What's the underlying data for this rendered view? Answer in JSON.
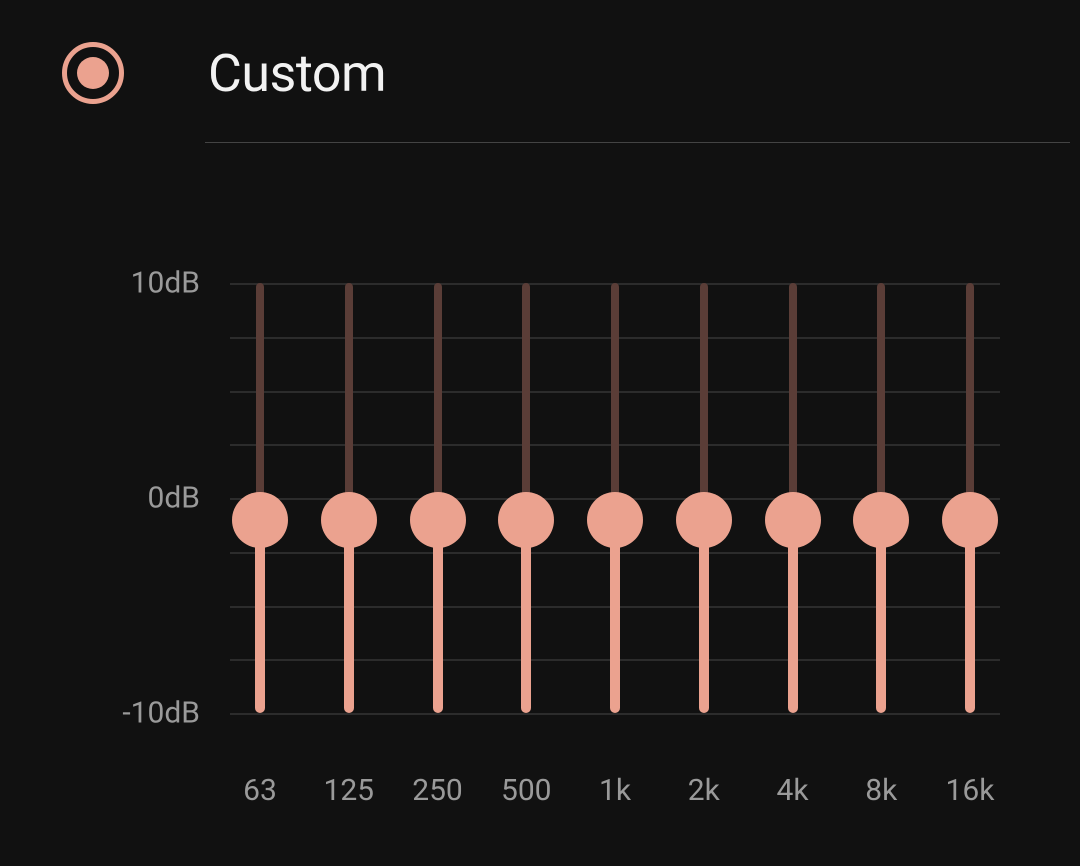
{
  "header": {
    "title": "Custom",
    "selected": true
  },
  "equalizer": {
    "y_axis": {
      "max_label": "10dB",
      "mid_label": "0dB",
      "min_label": "-10dB",
      "max": 10,
      "mid": 0,
      "min": -10
    },
    "gridlines_count": 8,
    "bands": [
      {
        "freq_label": "63",
        "value_db": -1
      },
      {
        "freq_label": "125",
        "value_db": -1
      },
      {
        "freq_label": "250",
        "value_db": -1
      },
      {
        "freq_label": "500",
        "value_db": -1
      },
      {
        "freq_label": "1k",
        "value_db": -1
      },
      {
        "freq_label": "2k",
        "value_db": -1
      },
      {
        "freq_label": "4k",
        "value_db": -1
      },
      {
        "freq_label": "8k",
        "value_db": -1
      },
      {
        "freq_label": "16k",
        "value_db": -1
      }
    ]
  },
  "chart_data": {
    "type": "bar",
    "title": "Custom",
    "xlabel": "",
    "ylabel": "dB",
    "ylim": [
      -10,
      10
    ],
    "categories": [
      "63",
      "125",
      "250",
      "500",
      "1k",
      "2k",
      "4k",
      "8k",
      "16k"
    ],
    "values": [
      -1,
      -1,
      -1,
      -1,
      -1,
      -1,
      -1,
      -1,
      -1
    ]
  }
}
